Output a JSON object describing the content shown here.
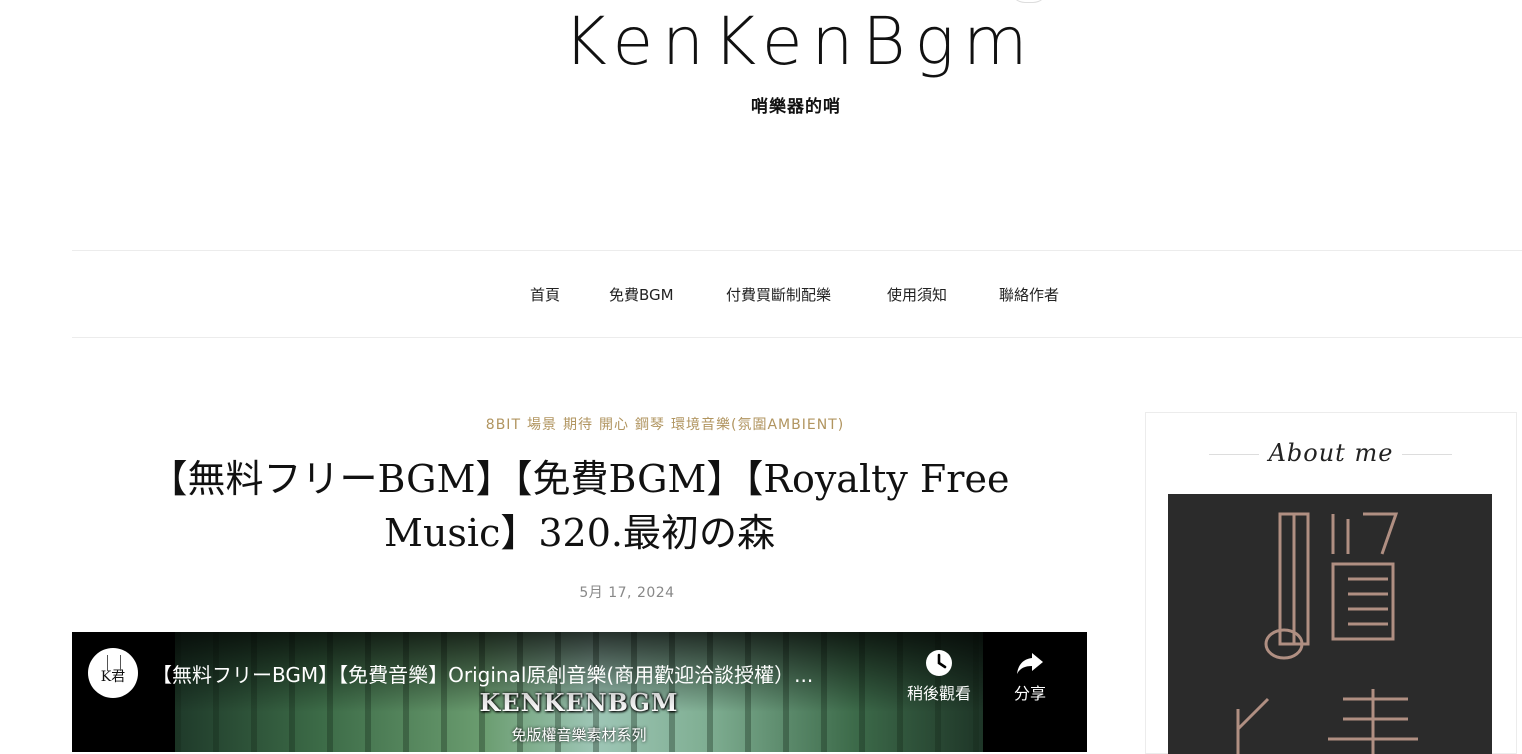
{
  "header": {
    "site_title": "KenKenBgm",
    "tagline": "哨樂器的哨"
  },
  "nav": {
    "items": [
      "首頁",
      "免費BGM",
      "付費買斷制配樂",
      "使用須知",
      "聯絡作者"
    ]
  },
  "post": {
    "categories": [
      "8BIT",
      "場景",
      "期待",
      "開心",
      "鋼琴",
      "環境音樂(氛圍AMBIENT)"
    ],
    "title_line1": "【無料フリーBGM】【免費BGM】【Royalty Free",
    "title_line2": "Music】320.最初の森",
    "date": "5月 17, 2024"
  },
  "video": {
    "channel_initials": "K君",
    "title": "【無料フリーBGM】【免費音樂】Original原創音樂(商用歡迎洽談授權）...",
    "watch_later_label": "稍後觀看",
    "share_label": "分享",
    "thumbnail_text": "KENKENBGM",
    "thumbnail_subtext": "免版權音樂素材系列"
  },
  "sidebar": {
    "widget_title": "About me"
  },
  "colors": {
    "accent": "#b19560",
    "text": "#222222",
    "muted": "#888888",
    "border": "#ececec"
  }
}
